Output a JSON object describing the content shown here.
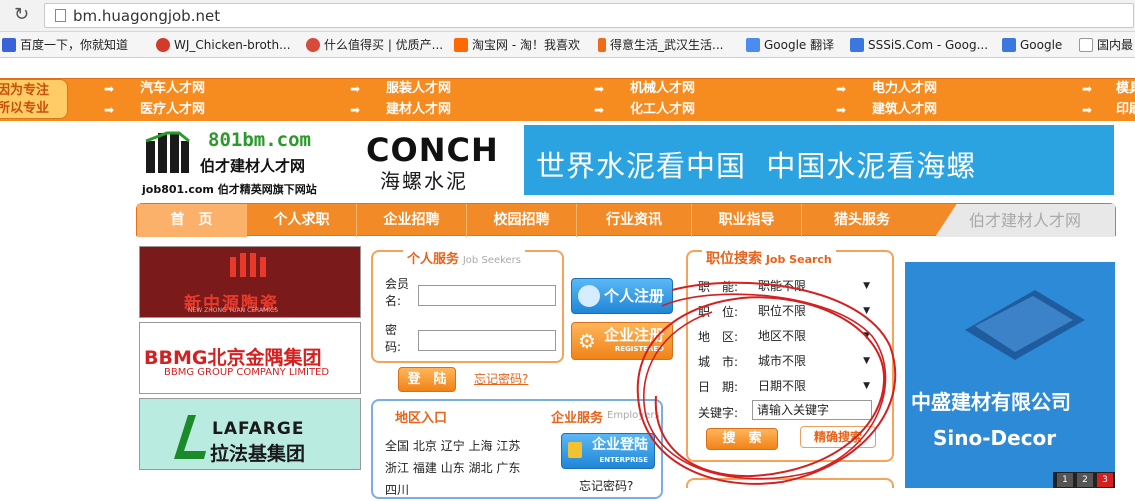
{
  "browser": {
    "url": "bm.huagongjob.net",
    "bookmarks": [
      {
        "label": "百度一下，你就知道",
        "color": "#3864d8"
      },
      {
        "label": "WJ_Chicken-broth...",
        "color": "#d23a2a"
      },
      {
        "label": "什么值得买 | 优质产...",
        "color": "#d84a3a"
      },
      {
        "label": "淘宝网 - 淘！我喜欢",
        "color": "#ff6a00"
      },
      {
        "label": "得意生活_武汉生活...",
        "color": "#ee6b1a"
      },
      {
        "label": "Google 翻译",
        "color": "#4a8cf0"
      },
      {
        "label": "SSSiS.Com - Goog...",
        "color": "#3a78e0"
      },
      {
        "label": "Google",
        "color": "#3a78e0"
      },
      {
        "label": "国内最",
        "color": "#ffffff"
      }
    ]
  },
  "catbar": {
    "slogan_line1": "因为专注",
    "slogan_line2": "所以专业",
    "row1": [
      "汽车人才网",
      "服装人才网",
      "机械人才网",
      "电力人才网",
      "模具"
    ],
    "row2": [
      "医疗人才网",
      "建材人才网",
      "化工人才网",
      "建筑人才网",
      "印刷"
    ]
  },
  "logo": {
    "domain": "801bm.com",
    "name": "伯才建材人才网",
    "tagline": "job801.com 伯才精英网旗下网站"
  },
  "banner": {
    "brand": "CONCH",
    "brand_cn": "海螺水泥",
    "slogan": "世界水泥看中国  中国水泥看海螺"
  },
  "nav": {
    "items": [
      "首　页",
      "个人求职",
      "企业招聘",
      "校园招聘",
      "行业资讯",
      "职业指导",
      "猎头服务"
    ],
    "right_label": "伯才建材人才网"
  },
  "ads": [
    {
      "label": "新中源陶瓷",
      "sub": "NEW ZHONG YUAN CERAMICS"
    },
    {
      "label": "BBMG北京金隅集团",
      "sub": "BBMG GROUP COMPANY LIMITED"
    },
    {
      "label": "LAFARGE",
      "sub": "拉法基集团"
    }
  ],
  "personal": {
    "title": "个人服务",
    "title_en": "Job Seekers",
    "member_label": "会员名:",
    "password_label": "密　码:",
    "login": "登　陆",
    "forgot": "忘记密码?",
    "register_person": "个人注册",
    "register_company": "企业注册",
    "register_company_en": "REGISTERED"
  },
  "region": {
    "title": "地区入口",
    "company_service": "企业服务",
    "company_service_en": "Employers",
    "cities": [
      "全国",
      "北京",
      "辽宁",
      "上海",
      "江苏",
      "浙江",
      "福建",
      "山东",
      "湖北",
      "广东",
      "四川"
    ],
    "company_login": "企业登陆",
    "company_login_en": "ENTERPRISE",
    "forgot": "忘记密码?"
  },
  "search": {
    "title": "职位搜索",
    "title_en": "Job Search",
    "fields": [
      {
        "label": "职　能:",
        "value": "职能不限"
      },
      {
        "label": "职　位:",
        "value": "职位不限"
      },
      {
        "label": "地　区:",
        "value": "地区不限"
      },
      {
        "label": "城　市:",
        "value": "城市不限"
      },
      {
        "label": "日　期:",
        "value": "日期不限"
      }
    ],
    "keyword_label": "关键字:",
    "keyword_placeholder": "请输入关键字",
    "search_button": "搜　索",
    "advanced_button": "精确搜索"
  },
  "right_ad": {
    "company": "中盛建材有限公司",
    "company_en": "Sino-Decor",
    "pages": [
      "1",
      "2",
      "3"
    ]
  },
  "annotation_color": "#d42020"
}
